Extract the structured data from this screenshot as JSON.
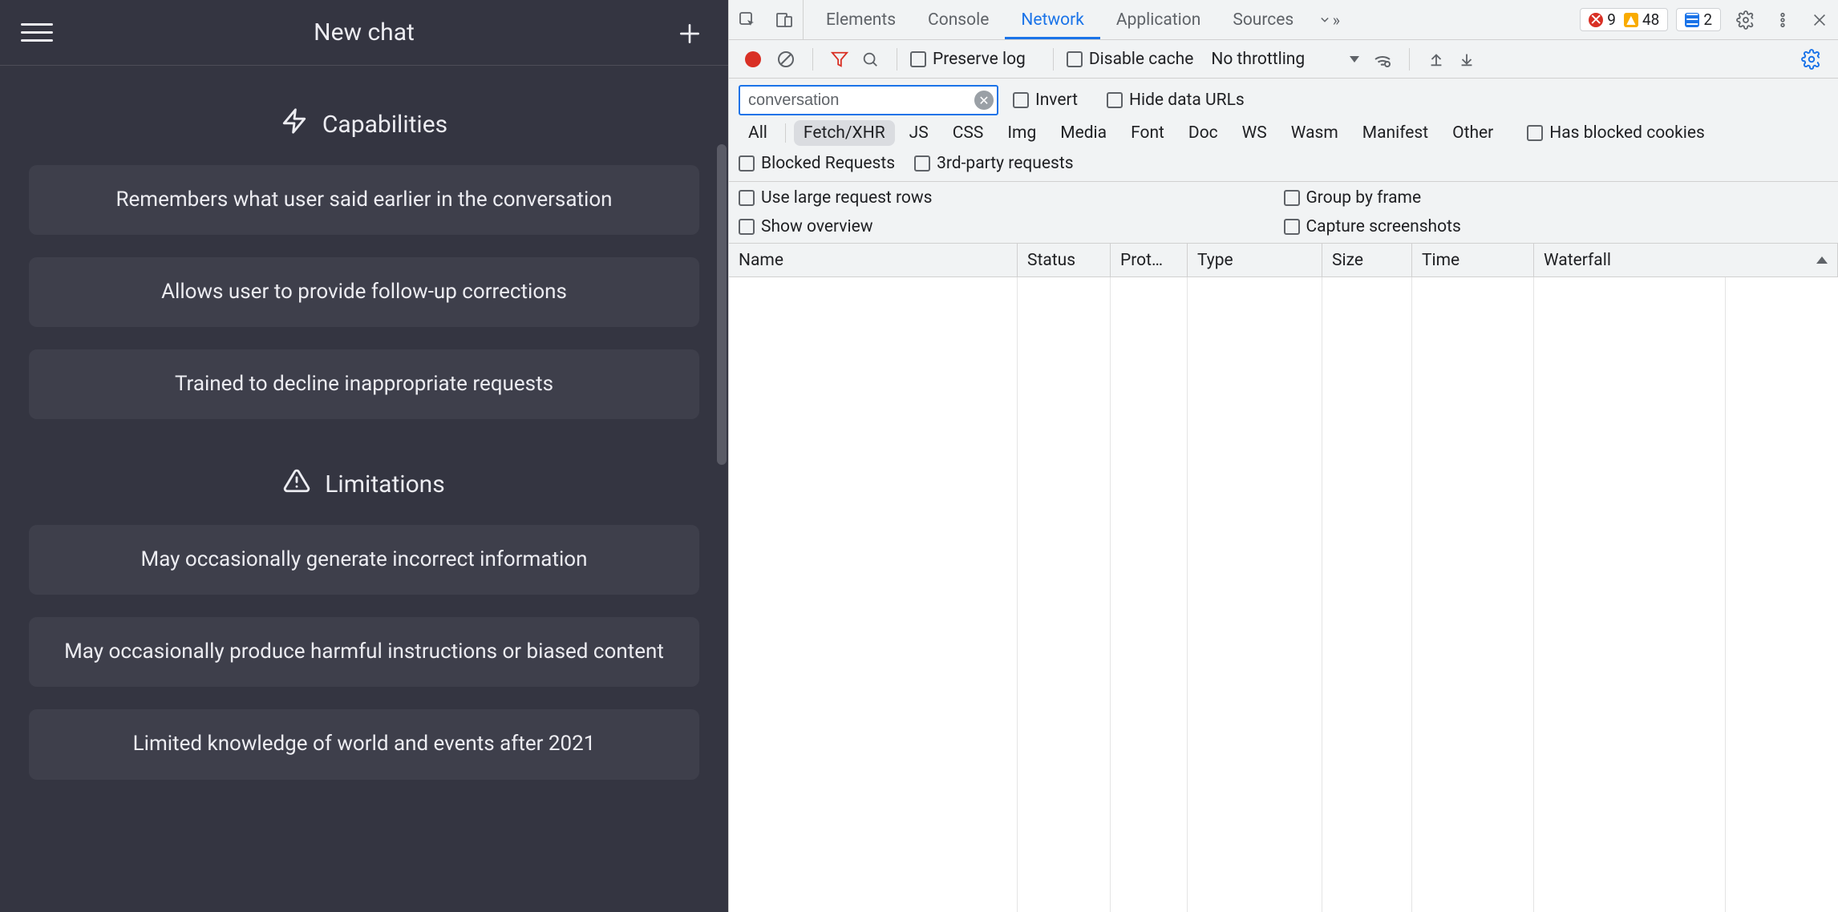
{
  "chat": {
    "title": "New chat",
    "sections": {
      "capabilities": {
        "label": "Capabilities",
        "items": [
          "Remembers what user said earlier in the conversation",
          "Allows user to provide follow-up corrections",
          "Trained to decline inappropriate requests"
        ]
      },
      "limitations": {
        "label": "Limitations",
        "items": [
          "May occasionally generate incorrect information",
          "May occasionally produce harmful instructions or biased content",
          "Limited knowledge of world and events after 2021"
        ]
      }
    }
  },
  "devtools": {
    "tabs": [
      "Elements",
      "Console",
      "Network",
      "Application",
      "Sources"
    ],
    "active_tab": "Network",
    "errors": 9,
    "warnings": 48,
    "messages": 2,
    "toolbar": {
      "preserve_log": "Preserve log",
      "disable_cache": "Disable cache",
      "throttling": "No throttling"
    },
    "filter": {
      "value": "conversation",
      "invert": "Invert",
      "hide_data_urls": "Hide data URLs"
    },
    "types": [
      "All",
      "Fetch/XHR",
      "JS",
      "CSS",
      "Img",
      "Media",
      "Font",
      "Doc",
      "WS",
      "Wasm",
      "Manifest",
      "Other"
    ],
    "selected_type": "Fetch/XHR",
    "has_blocked_cookies": "Has blocked cookies",
    "blocked_requests": "Blocked Requests",
    "third_party": "3rd-party requests",
    "options": {
      "large_rows": "Use large request rows",
      "group_by_frame": "Group by frame",
      "show_overview": "Show overview",
      "capture_screenshots": "Capture screenshots"
    },
    "columns": {
      "name": "Name",
      "status": "Status",
      "protocol": "Prot…",
      "type": "Type",
      "size": "Size",
      "time": "Time",
      "waterfall": "Waterfall"
    }
  }
}
